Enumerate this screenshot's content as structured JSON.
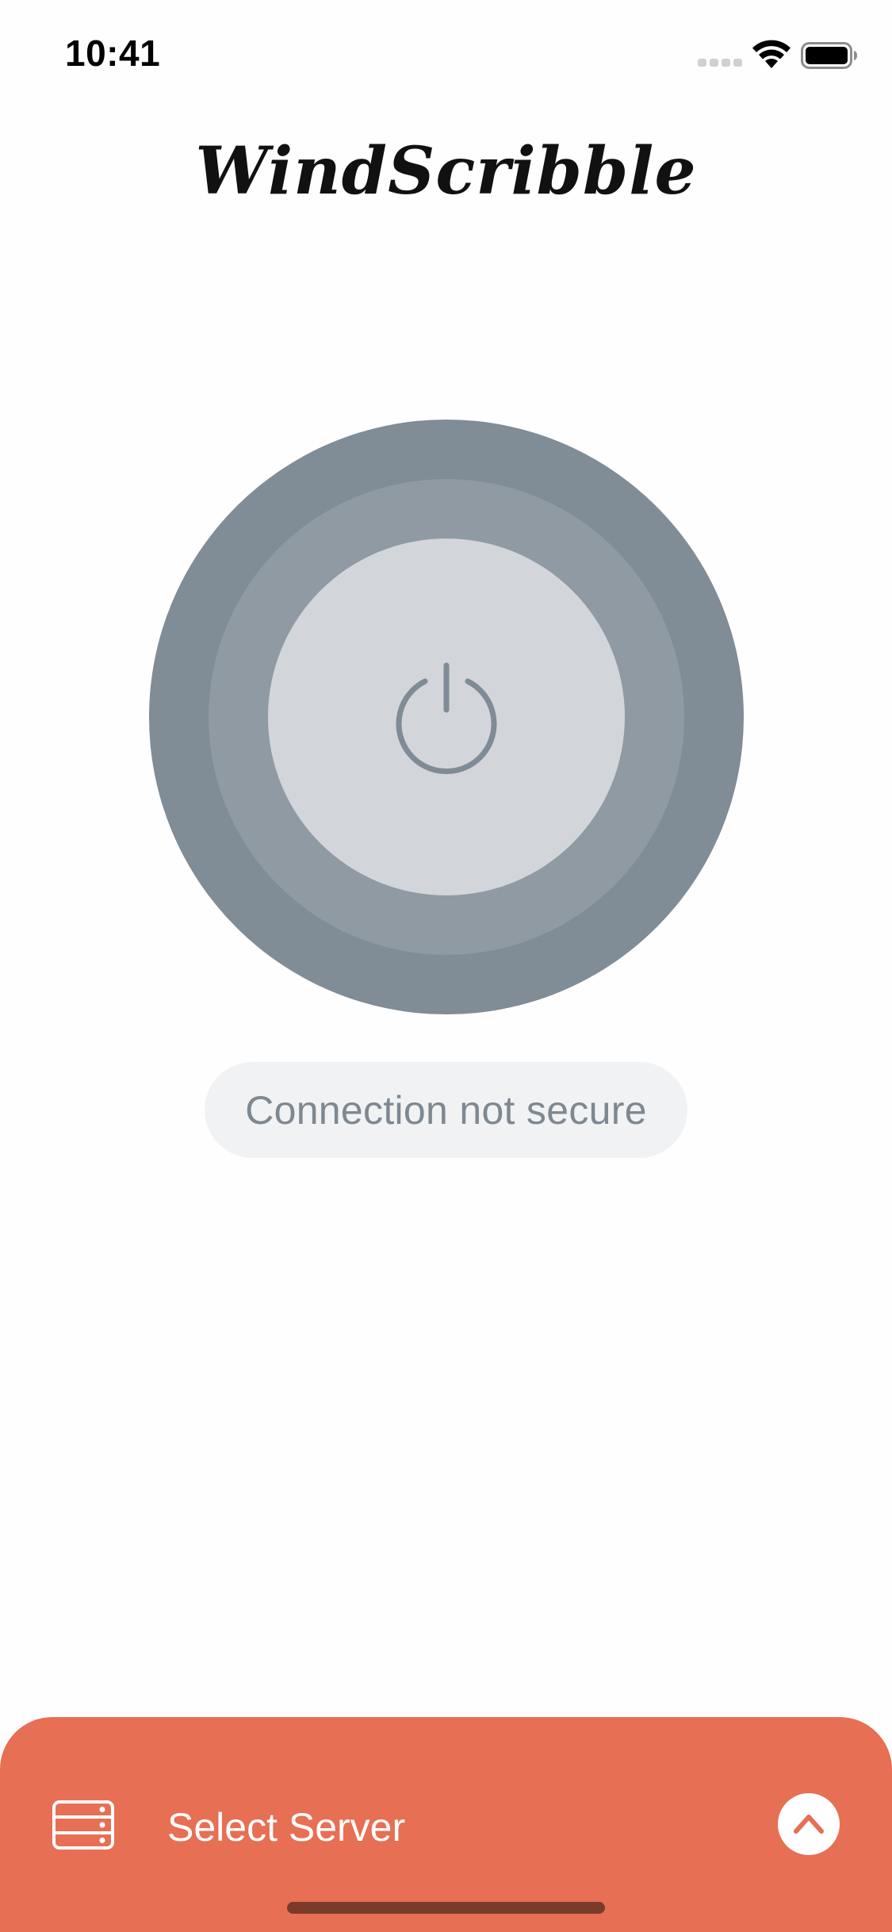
{
  "status_bar": {
    "time": "10:41",
    "icons": [
      "cellular-signal-icon",
      "wifi-icon",
      "battery-icon"
    ]
  },
  "app": {
    "title": "WindScribble"
  },
  "power_button": {
    "icon": "power-icon"
  },
  "connection": {
    "status": "Connection not secure"
  },
  "bottom_sheet": {
    "icon": "server-icon",
    "label": "Select Server",
    "expand_icon": "chevron-up-icon"
  },
  "colors": {
    "accent": "#e76f54",
    "ring_outer": "#808c96",
    "ring_middle": "#8f9aa3",
    "ring_inner": "#d2d6da",
    "status_text": "#7e8891"
  }
}
